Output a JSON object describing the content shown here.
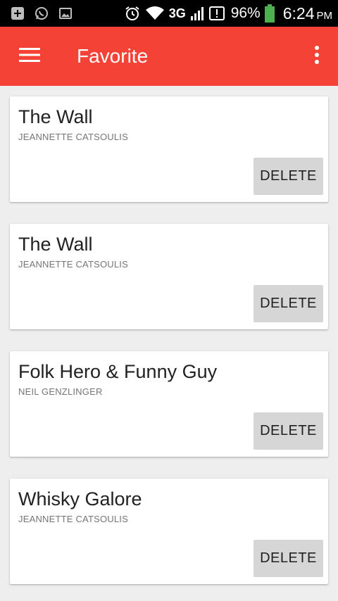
{
  "status_bar": {
    "battery": "96%",
    "time": "6:24",
    "ampm": "PM",
    "network": "3G",
    "icons": [
      "add-box-icon",
      "whatsapp-icon",
      "image-icon",
      "alarm-icon",
      "wifi-icon",
      "signal-icon",
      "sim-alert-icon",
      "battery-icon"
    ]
  },
  "app_bar": {
    "title": "Favorite",
    "color": "#f44336",
    "icons": [
      "menu-icon",
      "more-vert-icon"
    ]
  },
  "favorites": [
    {
      "title": "The Wall",
      "author": "JEANNETTE CATSOULIS",
      "action": "DELETE"
    },
    {
      "title": "The Wall",
      "author": "JEANNETTE CATSOULIS",
      "action": "DELETE"
    },
    {
      "title": "Folk Hero & Funny Guy",
      "author": "NEIL GENZLINGER",
      "action": "DELETE"
    },
    {
      "title": "Whisky Galore",
      "author": "JEANNETTE CATSOULIS",
      "action": "DELETE"
    }
  ]
}
